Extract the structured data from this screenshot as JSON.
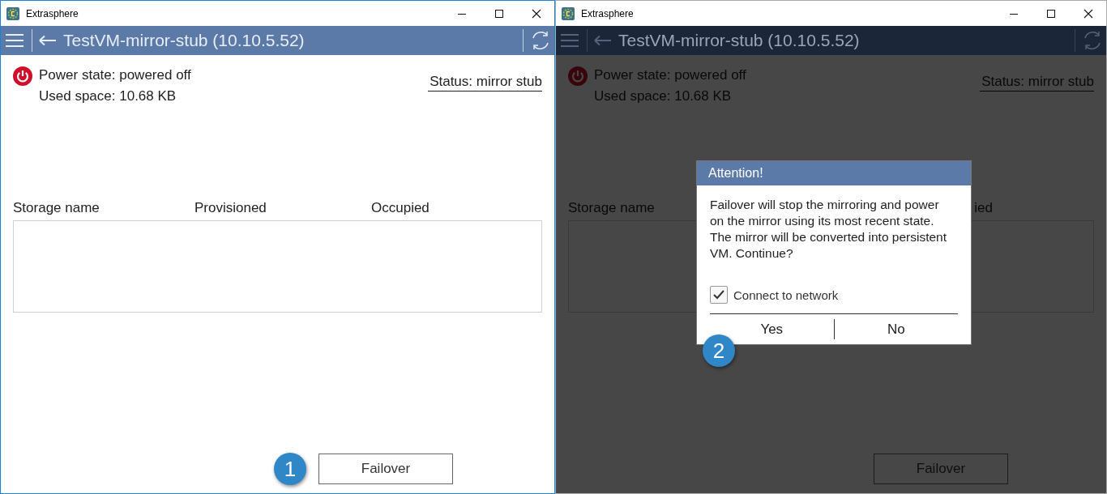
{
  "windows": [
    {
      "title": "Extrasphere",
      "active": true,
      "dimmed": false,
      "header": {
        "title": "TestVM-mirror-stub (10.10.5.52)"
      },
      "power_state": "Power state: powered off",
      "used_space": "Used space: 10.68 KB",
      "status": "Status: mirror stub",
      "table": {
        "columns": [
          {
            "label": "Storage name",
            "cut": false
          },
          {
            "label": "Provisioned",
            "cut": false
          },
          {
            "label": "Occupied",
            "cut": false
          }
        ]
      },
      "button": "Failover",
      "callout": "1"
    },
    {
      "title": "Extrasphere",
      "active": false,
      "dimmed": true,
      "header": {
        "title": "TestVM-mirror-stub (10.10.5.52)"
      },
      "power_state": "Power state: powered off",
      "used_space": "Used space: 10.68 KB",
      "status": "Status: mirror stub",
      "table": {
        "columns": [
          {
            "label": "Storage name",
            "cut": false
          },
          {
            "label": "ied",
            "cut": true
          }
        ]
      },
      "button": "Failover",
      "dialog": {
        "title": "Attention!",
        "message": "Failover will stop the mirroring and power on the mirror using its most recent state. The mirror will be converted into persistent VM. Continue?",
        "checkbox": {
          "label": "Connect to network",
          "checked": true
        },
        "buttons": [
          "Yes",
          "No"
        ],
        "callout": "2"
      }
    }
  ]
}
